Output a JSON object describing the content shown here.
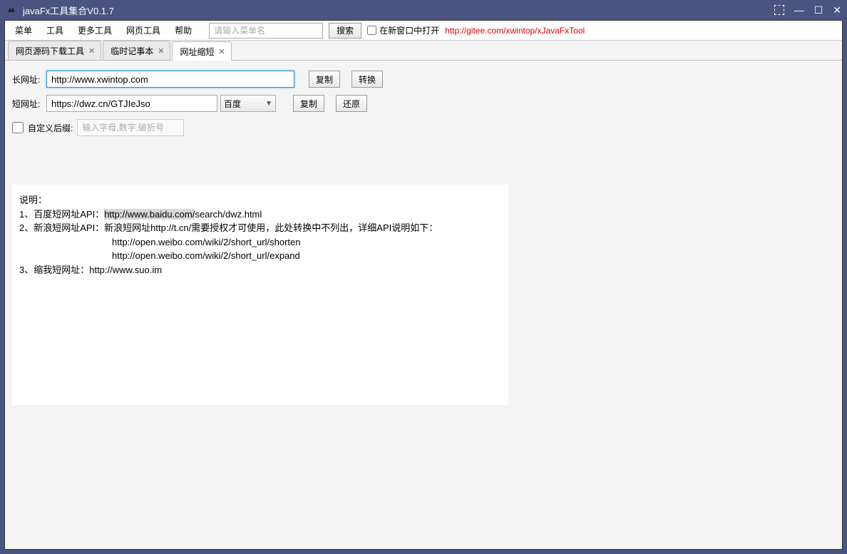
{
  "titlebar": {
    "title": "javaFx工具集合V0.1.7"
  },
  "menubar": {
    "items": [
      "菜单",
      "工具",
      "更多工具",
      "网页工具",
      "帮助"
    ],
    "search_placeholder": "请输入菜单名",
    "search_btn": "搜索",
    "new_window_label": "在新窗口中打开",
    "link": "http://gitee.com/xwintop/xJavaFxTool"
  },
  "tabs": [
    {
      "label": "网页源码下载工具",
      "active": false
    },
    {
      "label": "临时记事本",
      "active": false
    },
    {
      "label": "网址缩短",
      "active": true
    }
  ],
  "form": {
    "long_label": "长网址:",
    "long_value": "http://www.xwintop.com",
    "copy_btn": "复制",
    "convert_btn": "转换",
    "short_label": "短网址:",
    "short_value": "https://dwz.cn/GTJIeJso",
    "provider": "百度",
    "restore_btn": "还原",
    "suffix_label": "自定义后缀:",
    "suffix_placeholder": "输入字母,数字,破折号"
  },
  "info": {
    "header": "说明：",
    "line1a": "1、百度短网址API：",
    "line1b": "http://www.baidu.com/",
    "line1c": "search/dwz.html",
    "line2": "2、新浪短网址API：新浪短网址http://t.cn/需要授权才可使用，此处转换中不列出，详细API说明如下：",
    "line2a": "http://open.weibo.com/wiki/2/short_url/shorten",
    "line2b": "http://open.weibo.com/wiki/2/short_url/expand",
    "line3": "3、缩我短网址：http://www.suo.im"
  }
}
